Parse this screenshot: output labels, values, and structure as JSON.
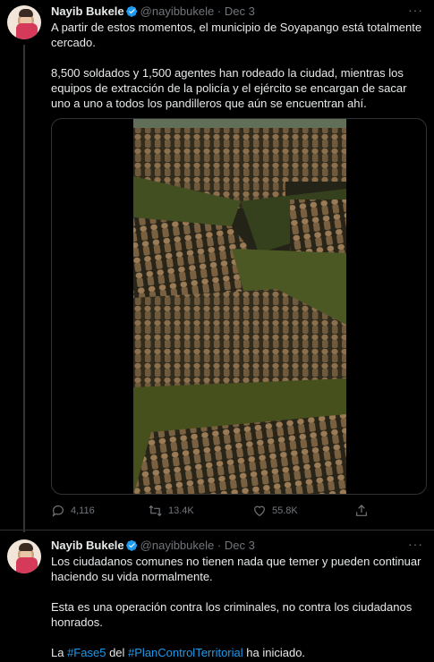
{
  "tweets": [
    {
      "author": {
        "name": "Nayib Bukele",
        "handle": "@nayibbukele",
        "separator": "·",
        "date": "Dec 3"
      },
      "text": [
        "A partir de estos momentos, el municipio de Soyapango está totalmente cercado.",
        "8,500 soldados y 1,500 agentes han rodeado la ciudad, mientras los equipos de extracción de la policía y el ejército se encargan de sacar uno a uno a todos los pandilleros que aún se encuentran ahí."
      ],
      "stats": {
        "replies": "4,116",
        "retweets": "13.4K",
        "likes": "55.8K"
      }
    },
    {
      "author": {
        "name": "Nayib Bukele",
        "handle": "@nayibbukele",
        "separator": "·",
        "date": "Dec 3"
      },
      "text": [
        "Los ciudadanos comunes no tienen nada que temer y pueden continuar haciendo su vida normalmente.",
        "Esta es una operación contra los criminales, no contra los ciudadanos honrados."
      ],
      "last_line": {
        "pre": "La ",
        "tag1": "#Fase5",
        "mid": " del ",
        "tag2": "#PlanControlTerritorial",
        "post": " ha iniciado."
      }
    }
  ],
  "icons": {
    "more": "more-icon",
    "verified": "verified-badge-icon",
    "reply": "reply-icon",
    "retweet": "retweet-icon",
    "like": "heart-icon",
    "share": "share-icon"
  },
  "colors": {
    "background": "#000000",
    "text": "#e7e9ea",
    "muted": "#71767b",
    "accent": "#1d9bf0"
  }
}
